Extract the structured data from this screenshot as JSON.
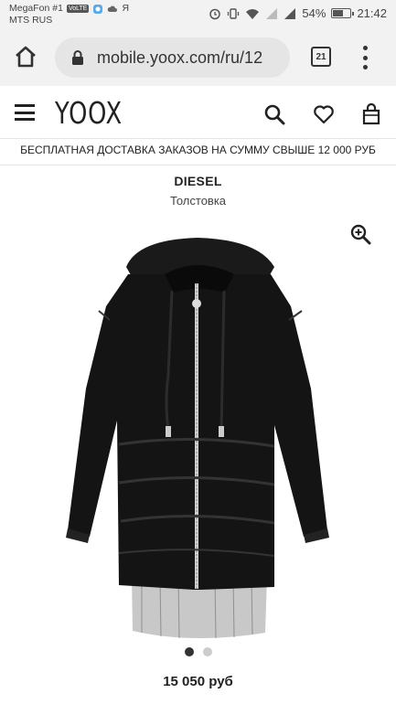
{
  "status_bar": {
    "carrier1": "MegaFon #1",
    "volte_badge": "VoLTE",
    "carrier2": "MTS RUS",
    "yandex_icon": "Я",
    "battery_percent": "54%",
    "battery_level": 0.54,
    "time": "21:42"
  },
  "browser": {
    "url": "mobile.yoox.com/ru/12",
    "tab_count": "21"
  },
  "header": {
    "logo": "YOOX"
  },
  "promo": {
    "text": "БЕСПЛАТНАЯ ДОСТАВКА ЗАКАЗОВ НА СУММУ СВЫШЕ 12 000 РУБ"
  },
  "product": {
    "brand": "DIESEL",
    "category": "Толстовка",
    "price": "15 050 руб",
    "image_count": 2,
    "active_image": 0
  },
  "colors": {
    "status_bg": "#f2f2f2",
    "url_bg": "#e5e5e5",
    "text": "#222222",
    "dot_active": "#333333",
    "dot_inactive": "#cccccc"
  }
}
